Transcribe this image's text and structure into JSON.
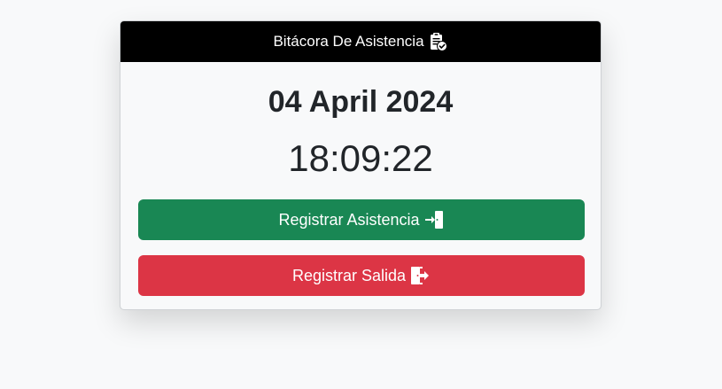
{
  "header": {
    "title": "Bitácora De Asistencia",
    "icon": "clipboard-check-icon"
  },
  "date": "04 April 2024",
  "time": "18:09:22",
  "buttons": {
    "register_attendance": {
      "label": "Registrar Asistencia",
      "icon": "door-enter-icon",
      "color": "#198754"
    },
    "register_exit": {
      "label": "Registrar Salida",
      "icon": "door-exit-icon",
      "color": "#dc3545"
    }
  },
  "colors": {
    "header_bg": "#000000",
    "page_bg": "#f8f9fa",
    "text": "#212529"
  }
}
